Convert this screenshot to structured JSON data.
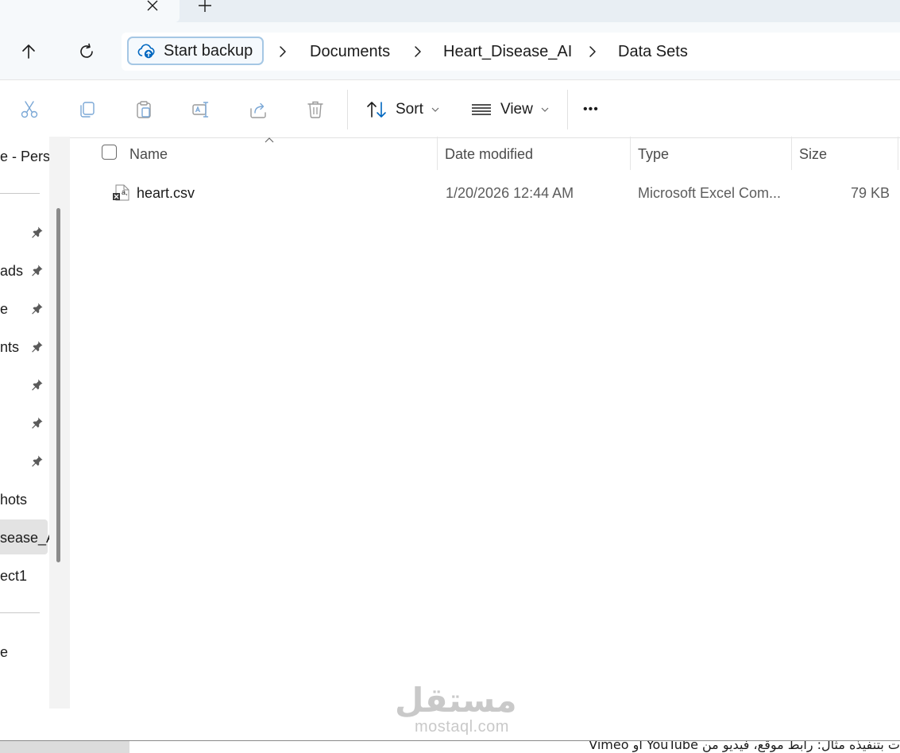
{
  "tabs": {
    "close_glyph": "✕",
    "new_tab_glyph": "+"
  },
  "address": {
    "backup_label": "Start backup",
    "crumbs": [
      "Documents",
      "Heart_Disease_AI",
      "Data Sets"
    ]
  },
  "toolbar": {
    "sort_label": "Sort",
    "view_label": "View",
    "more_label": "•••"
  },
  "nav": {
    "top_label": "e - Perso",
    "items": [
      {
        "label": "",
        "pinned": true
      },
      {
        "label": "ads",
        "pinned": true
      },
      {
        "label": "e",
        "pinned": true
      },
      {
        "label": "nts",
        "pinned": true
      },
      {
        "label": "",
        "pinned": true
      },
      {
        "label": "",
        "pinned": true
      },
      {
        "label": "",
        "pinned": true
      },
      {
        "label": "hots",
        "pinned": false
      },
      {
        "label": "sease_A",
        "pinned": false,
        "selected": true
      },
      {
        "label": "ect1",
        "pinned": false
      },
      {
        "label": "e",
        "pinned": false
      }
    ]
  },
  "details": {
    "columns": {
      "name": "Name",
      "date": "Date modified",
      "type": "Type",
      "size": "Size"
    },
    "rows": [
      {
        "name": "heart.csv",
        "date": "1/20/2026 12:44 AM",
        "type": "Microsoft Excel Com...",
        "size": "79 KB"
      }
    ]
  },
  "bottom": {
    "text": "ت بتنفيذه مثال: رابط موقع، فيديو من YouTube أو Vimeo"
  },
  "watermark": {
    "arabic": "مستقل",
    "latin": "mostaql.com"
  },
  "colors": {
    "accent": "#0067c0",
    "pin": "#5a5a5a",
    "backup_border": "#a5c7e4"
  }
}
